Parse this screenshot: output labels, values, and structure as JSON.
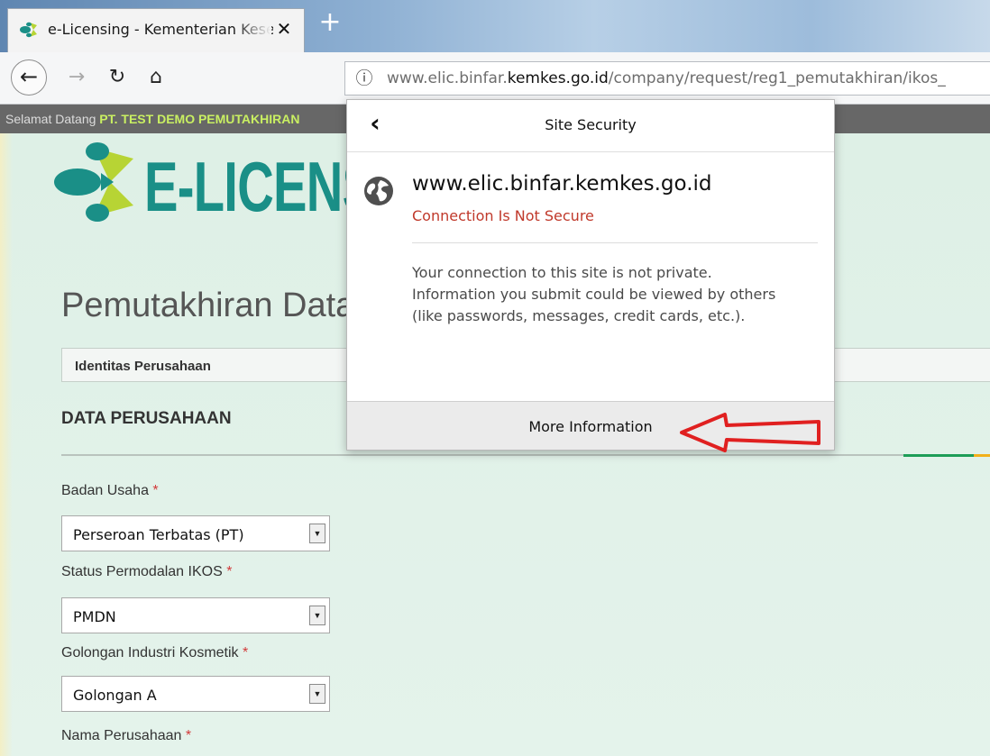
{
  "browser": {
    "tab_title": "e-Licensing - Kementerian Kesehatan",
    "close_tab_glyph": "✕",
    "new_tab_glyph": "+",
    "nav": {
      "back_glyph": "←",
      "forward_glyph": "→",
      "reload_glyph": "↻",
      "home_glyph": "⌂"
    },
    "url": {
      "info_glyph": "ⓘ",
      "prefix": "www.elic.binfar.",
      "domain": "kemkes.go.id",
      "path": "/company/request/reg1_pemutakhiran/ikos_"
    }
  },
  "page": {
    "welcome_prefix": "Selamat Datang ",
    "company_name": "PT. TEST DEMO PEMUTAKHIRAN",
    "logo_text": "E-LICENSING",
    "title": "Pemutakhiran Data",
    "tab_label": "Identitas Perusahaan",
    "section_title": "DATA PERUSAHAAN",
    "fields": [
      {
        "label": "Badan Usaha",
        "required_mark": "*",
        "value": "Perseroan Terbatas (PT)"
      },
      {
        "label": "Status Permodalan IKOS",
        "required_mark": "*",
        "value": "PMDN"
      },
      {
        "label": "Golongan Industri Kosmetik",
        "required_mark": "*",
        "value": "Golongan A"
      },
      {
        "label": "Nama Perusahaan",
        "required_mark": "*"
      }
    ],
    "select_arrow_glyph": "▼"
  },
  "popup": {
    "back_glyph": "‹",
    "title": "Site Security",
    "host": "www.elic.binfar.kemkes.go.id",
    "status": "Connection Is Not Secure",
    "description": "Your connection to this site is not private. Information you submit could be viewed by others (like passwords, messages, credit cards, etc.).",
    "more_info": "More Information"
  },
  "colors": {
    "warning_red": "#c0392b",
    "logo_teal": "#1a8f87",
    "logo_lime": "#b7d434",
    "annotation_red": "#e02020"
  }
}
